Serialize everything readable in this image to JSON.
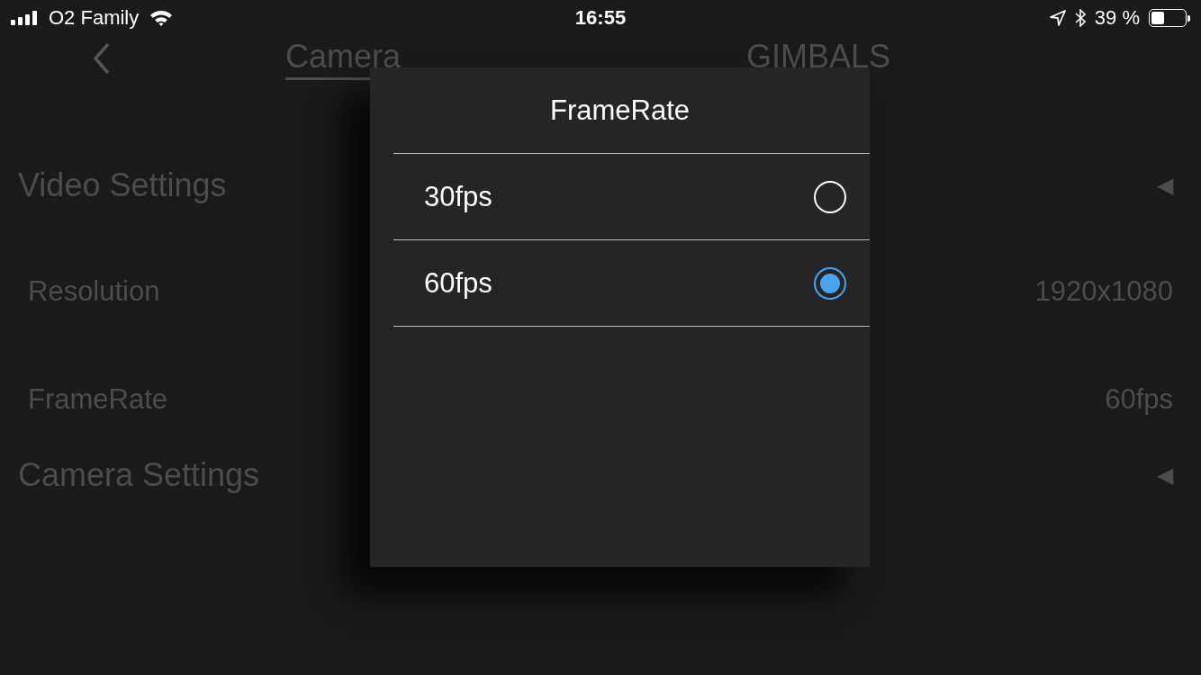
{
  "status_bar": {
    "carrier": "O2 Family",
    "time": "16:55",
    "battery_text": "39 %",
    "battery": {
      "level": 0.39
    }
  },
  "nav": {
    "tabs": [
      {
        "label": "Camera",
        "selected": true
      },
      {
        "label": "GIMBALS",
        "selected": false
      }
    ]
  },
  "sections": [
    {
      "kind": "header",
      "label": "Video Settings",
      "arrow": "◀"
    },
    {
      "kind": "setting",
      "label": "Resolution",
      "value": "1920x1080"
    },
    {
      "kind": "setting",
      "label": "FrameRate",
      "value": "60fps"
    },
    {
      "kind": "header",
      "label": "Camera Settings",
      "arrow": "◀"
    }
  ],
  "dialog": {
    "title": "FrameRate",
    "options": [
      {
        "label": "30fps",
        "selected": false
      },
      {
        "label": "60fps",
        "selected": true
      }
    ]
  }
}
